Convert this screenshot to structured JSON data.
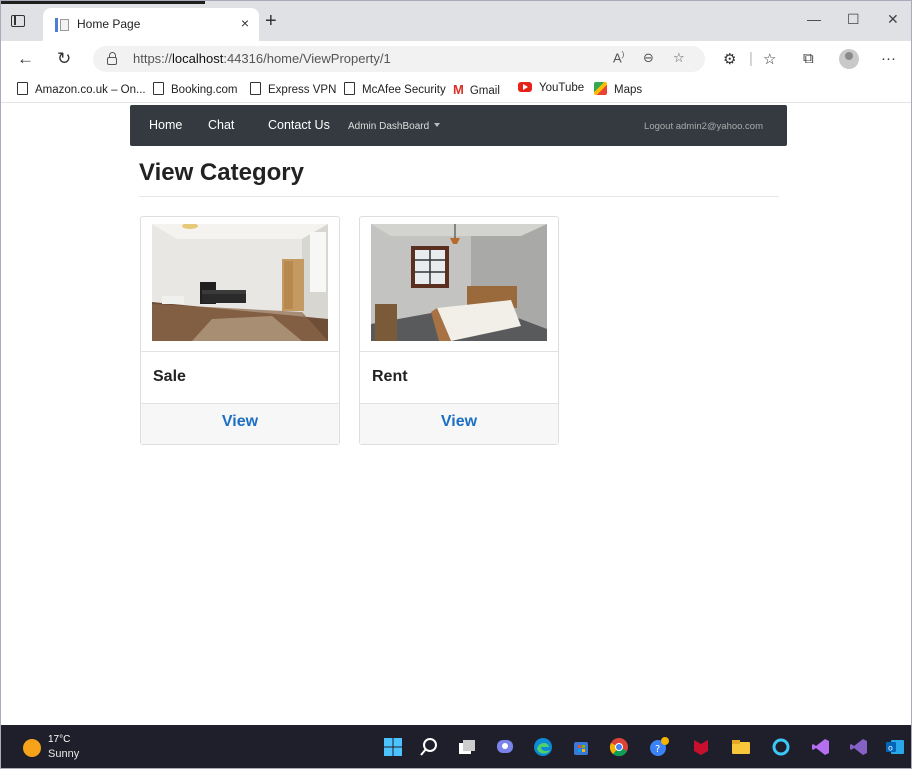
{
  "browser": {
    "tab_title": "Home Page",
    "tab_close": "×",
    "new_tab": "+",
    "url_prefix": "https://",
    "url_host": "localhost",
    "url_rest": ":44316/home/ViewProperty/1",
    "window_controls": {
      "minimize": "—",
      "maximize": "☐",
      "close": "✕"
    },
    "nav": {
      "back": "←",
      "refresh": "↻"
    },
    "menu": "···"
  },
  "favorites": [
    {
      "label": "Amazon.co.uk – On...",
      "icon": "page-icon"
    },
    {
      "label": "Booking.com",
      "icon": "page-icon"
    },
    {
      "label": "Express VPN",
      "icon": "page-icon"
    },
    {
      "label": "McAfee Security",
      "icon": "page-icon"
    },
    {
      "label": "Gmail",
      "icon": "gmail-icon"
    },
    {
      "label": "YouTube",
      "icon": "youtube-icon"
    },
    {
      "label": "Maps",
      "icon": "maps-icon"
    }
  ],
  "site_nav": {
    "home": "Home",
    "chat": "Chat",
    "contact": "Contact Us",
    "admin": "Admin DashBoard",
    "logout": "Logout admin2@yahoo.com"
  },
  "page": {
    "heading": "View Category",
    "cards": [
      {
        "category": "Sale",
        "action": "View"
      },
      {
        "category": "Rent",
        "action": "View"
      }
    ]
  },
  "taskbar": {
    "temperature": "17°C",
    "weather": "Sunny"
  },
  "colors": {
    "navbar_bg": "#343a40",
    "link_blue": "#1d6fc4",
    "taskbar_bg": "#1f1f2b"
  }
}
